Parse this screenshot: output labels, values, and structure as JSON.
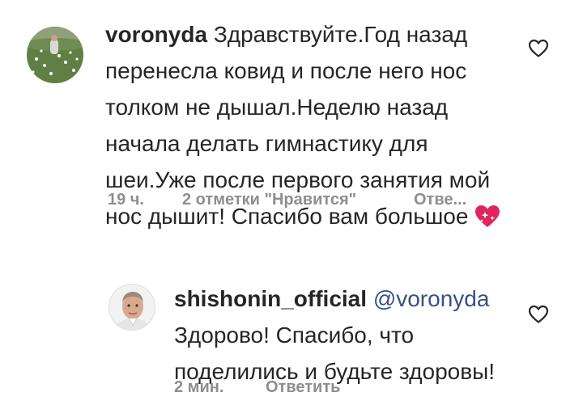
{
  "comments": [
    {
      "username": "voronyda",
      "mention": "",
      "text": "Здравствуйте.Год назад перенесла ковид и после него нос толком не дышал.Неделю назад начала делать гимнастику для шеи.Уже после первого занятия мой нос дышит! Спасибо вам большое",
      "emoji": "sparkling-heart-icon",
      "time": "19 ч.",
      "likes": "2 отметки \"Нравится\"",
      "reply": "Отве..."
    },
    {
      "username": "shishonin_official",
      "mention": "@voronyda",
      "text": "Здорово! Спасибо, что поделились и будьте здоровы!",
      "time": "2 мин.",
      "reply": "Ответить"
    }
  ],
  "colors": {
    "text": "#262626",
    "meta": "#8e8e8e",
    "mention": "#385185",
    "heart": "#e0245e"
  }
}
